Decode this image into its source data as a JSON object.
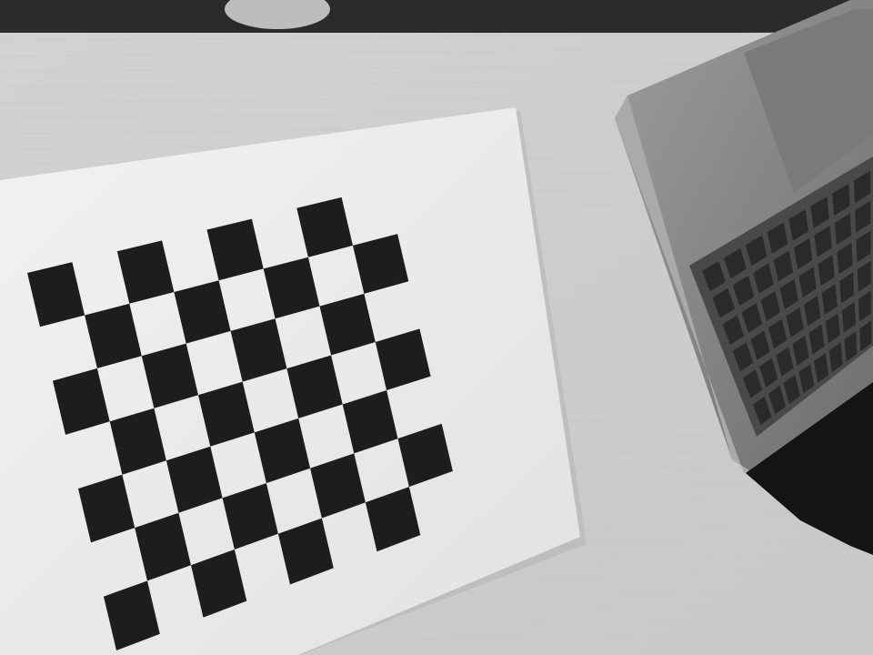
{
  "scene": {
    "palette": {
      "background_strip": "#2e2e2e",
      "desk": "#d7d7d7",
      "desk_grain": "#c6c6c6",
      "paper": "#ebebeb",
      "paper_shadow": "#b9b9b9",
      "checker_dark": "#1d1d1d",
      "laptop_body": "#8e8e8e",
      "laptop_edge": "#a9a9a9",
      "keyboard_well": "#4a4a4a",
      "key": "#2a2a2a",
      "trackpad": "#7d7d7d",
      "mug": "#bdbdbd"
    },
    "checkerboard": {
      "rows": 7,
      "cols": 8
    },
    "keyboard": {
      "rows": 6,
      "cols": 8
    }
  }
}
